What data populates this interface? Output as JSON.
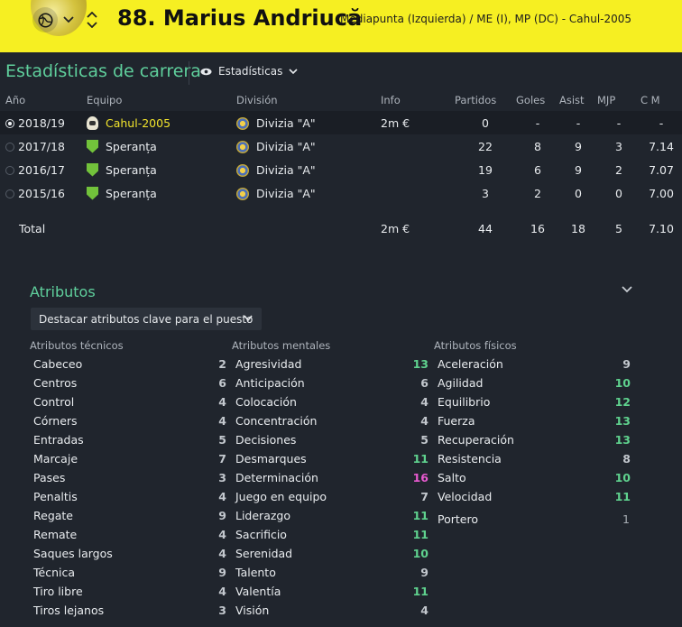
{
  "header": {
    "player_name": "88. Marius Andriucă",
    "player_meta": "Mediapunta (Izquierda) / ME (I), MP (DC) - Cahul-2005",
    "nav_icons": [
      "globe-icon",
      "chevron-down-icon",
      "chevron-up-down-icon"
    ]
  },
  "career": {
    "title": "Estadísticas de carrera",
    "view_dropdown": "Estadísticas",
    "columns": {
      "year": "Año",
      "team": "Equipo",
      "division": "División",
      "info": "Info",
      "apps": "Partidos",
      "goals": "Goles",
      "assists": "Asist",
      "mom": "MJP",
      "avg": "C M"
    },
    "rows": [
      {
        "year": "2018/19",
        "team": "Cahul-2005",
        "division": "Divizia \"A\"",
        "info": "2m €",
        "apps": "0",
        "goals": "-",
        "assists": "-",
        "mom": "-",
        "avg": "-"
      },
      {
        "year": "2017/18",
        "team": "Speranța",
        "division": "Divizia \"A\"",
        "info": "",
        "apps": "22",
        "goals": "8",
        "assists": "9",
        "mom": "3",
        "avg": "7.14"
      },
      {
        "year": "2016/17",
        "team": "Speranța",
        "division": "Divizia \"A\"",
        "info": "",
        "apps": "19",
        "goals": "6",
        "assists": "9",
        "mom": "2",
        "avg": "7.07"
      },
      {
        "year": "2015/16",
        "team": "Speranța",
        "division": "Divizia \"A\"",
        "info": "",
        "apps": "3",
        "goals": "2",
        "assists": "0",
        "mom": "0",
        "avg": "7.00"
      }
    ],
    "total": {
      "label": "Total",
      "info": "2m €",
      "apps": "44",
      "goals": "16",
      "assists": "18",
      "mom": "5",
      "avg": "7.10"
    }
  },
  "attributes": {
    "title": "Atributos",
    "highlight_dropdown": "Destacar atributos clave para el puesto",
    "technical": {
      "header": "Atributos técnicos",
      "items": [
        {
          "name": "Cabeceo",
          "value": "2"
        },
        {
          "name": "Centros",
          "value": "6"
        },
        {
          "name": "Control",
          "value": "4"
        },
        {
          "name": "Córners",
          "value": "4"
        },
        {
          "name": "Entradas",
          "value": "5"
        },
        {
          "name": "Marcaje",
          "value": "7"
        },
        {
          "name": "Pases",
          "value": "3"
        },
        {
          "name": "Penaltis",
          "value": "4"
        },
        {
          "name": "Regate",
          "value": "9"
        },
        {
          "name": "Remate",
          "value": "4"
        },
        {
          "name": "Saques largos",
          "value": "4"
        },
        {
          "name": "Técnica",
          "value": "9"
        },
        {
          "name": "Tiro libre",
          "value": "4"
        },
        {
          "name": "Tiros lejanos",
          "value": "3"
        }
      ]
    },
    "mental": {
      "header": "Atributos mentales",
      "items": [
        {
          "name": "Agresividad",
          "value": "13"
        },
        {
          "name": "Anticipación",
          "value": "6"
        },
        {
          "name": "Colocación",
          "value": "4"
        },
        {
          "name": "Concentración",
          "value": "4"
        },
        {
          "name": "Decisiones",
          "value": "5"
        },
        {
          "name": "Desmarques",
          "value": "11"
        },
        {
          "name": "Determinación",
          "value": "16"
        },
        {
          "name": "Juego en equipo",
          "value": "7"
        },
        {
          "name": "Liderazgo",
          "value": "11"
        },
        {
          "name": "Sacrificio",
          "value": "11"
        },
        {
          "name": "Serenidad",
          "value": "10"
        },
        {
          "name": "Talento",
          "value": "9"
        },
        {
          "name": "Valentía",
          "value": "11"
        },
        {
          "name": "Visión",
          "value": "4"
        }
      ]
    },
    "physical": {
      "header": "Atributos físicos",
      "items": [
        {
          "name": "Aceleración",
          "value": "9"
        },
        {
          "name": "Agilidad",
          "value": "10"
        },
        {
          "name": "Equilibrio",
          "value": "12"
        },
        {
          "name": "Fuerza",
          "value": "13"
        },
        {
          "name": "Recuperación",
          "value": "13"
        },
        {
          "name": "Resistencia",
          "value": "8"
        },
        {
          "name": "Salto",
          "value": "10"
        },
        {
          "name": "Velocidad",
          "value": "11"
        }
      ]
    },
    "goalkeeper": {
      "name": "Portero",
      "value": "1"
    }
  },
  "colors": {
    "header_bg": "#f6ef22",
    "accent": "#5fcf9c",
    "value_green": "#5fd28e",
    "value_pink": "#e85ad0",
    "page_bg": "#20252d"
  }
}
